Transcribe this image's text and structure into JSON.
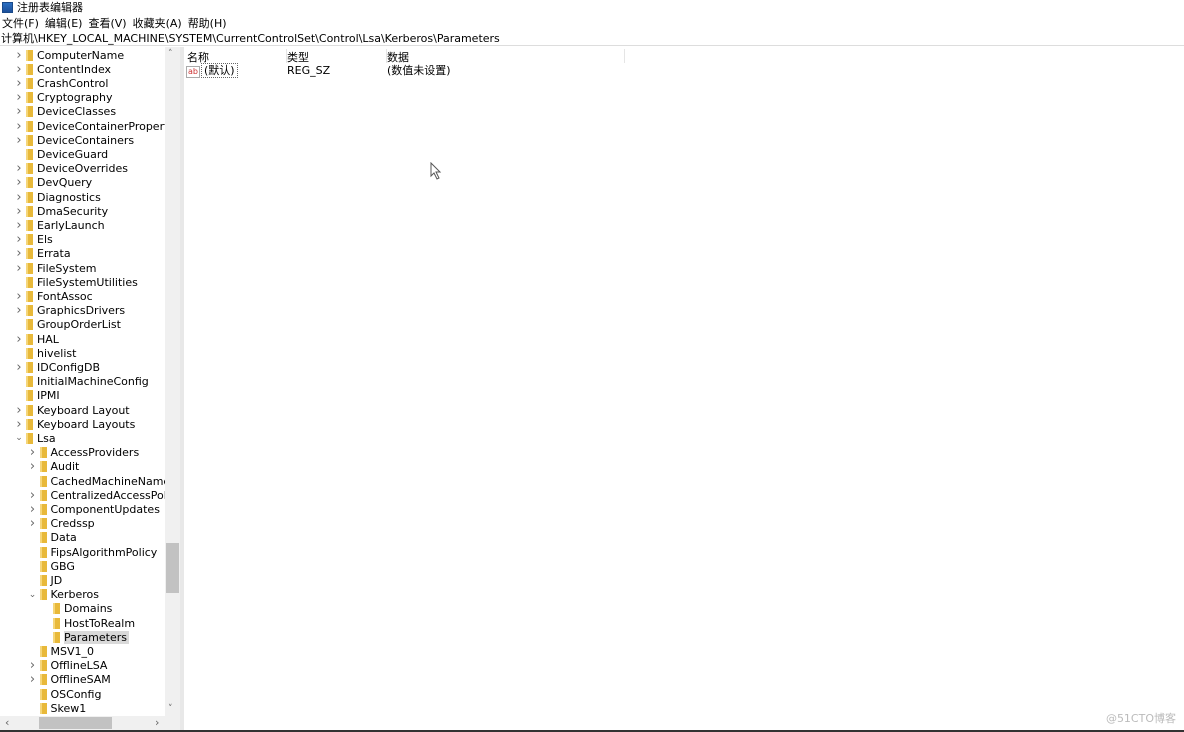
{
  "window": {
    "title": "注册表编辑器",
    "icon": "registry-editor-icon"
  },
  "menu": [
    "文件(F)",
    "编辑(E)",
    "查看(V)",
    "收藏夹(A)",
    "帮助(H)"
  ],
  "address": "计算机\\HKEY_LOCAL_MACHINE\\SYSTEM\\CurrentControlSet\\Control\\Lsa\\Kerberos\\Parameters",
  "tree": [
    {
      "label": "ComputerName",
      "level": 0,
      "state": "collapsed"
    },
    {
      "label": "ContentIndex",
      "level": 0,
      "state": "collapsed"
    },
    {
      "label": "CrashControl",
      "level": 0,
      "state": "collapsed"
    },
    {
      "label": "Cryptography",
      "level": 0,
      "state": "collapsed"
    },
    {
      "label": "DeviceClasses",
      "level": 0,
      "state": "collapsed"
    },
    {
      "label": "DeviceContainerPropertyU",
      "level": 0,
      "state": "collapsed"
    },
    {
      "label": "DeviceContainers",
      "level": 0,
      "state": "collapsed"
    },
    {
      "label": "DeviceGuard",
      "level": 0,
      "state": "leaf"
    },
    {
      "label": "DeviceOverrides",
      "level": 0,
      "state": "collapsed"
    },
    {
      "label": "DevQuery",
      "level": 0,
      "state": "collapsed"
    },
    {
      "label": "Diagnostics",
      "level": 0,
      "state": "collapsed"
    },
    {
      "label": "DmaSecurity",
      "level": 0,
      "state": "collapsed"
    },
    {
      "label": "EarlyLaunch",
      "level": 0,
      "state": "collapsed"
    },
    {
      "label": "Els",
      "level": 0,
      "state": "collapsed"
    },
    {
      "label": "Errata",
      "level": 0,
      "state": "collapsed"
    },
    {
      "label": "FileSystem",
      "level": 0,
      "state": "collapsed"
    },
    {
      "label": "FileSystemUtilities",
      "level": 0,
      "state": "leaf"
    },
    {
      "label": "FontAssoc",
      "level": 0,
      "state": "collapsed"
    },
    {
      "label": "GraphicsDrivers",
      "level": 0,
      "state": "collapsed"
    },
    {
      "label": "GroupOrderList",
      "level": 0,
      "state": "leaf"
    },
    {
      "label": "HAL",
      "level": 0,
      "state": "collapsed"
    },
    {
      "label": "hivelist",
      "level": 0,
      "state": "leaf"
    },
    {
      "label": "IDConfigDB",
      "level": 0,
      "state": "collapsed"
    },
    {
      "label": "InitialMachineConfig",
      "level": 0,
      "state": "leaf"
    },
    {
      "label": "IPMI",
      "level": 0,
      "state": "leaf"
    },
    {
      "label": "Keyboard Layout",
      "level": 0,
      "state": "collapsed"
    },
    {
      "label": "Keyboard Layouts",
      "level": 0,
      "state": "collapsed"
    },
    {
      "label": "Lsa",
      "level": 0,
      "state": "expanded"
    },
    {
      "label": "AccessProviders",
      "level": 1,
      "state": "collapsed"
    },
    {
      "label": "Audit",
      "level": 1,
      "state": "collapsed"
    },
    {
      "label": "CachedMachineNames",
      "level": 1,
      "state": "leaf"
    },
    {
      "label": "CentralizedAccessPolici",
      "level": 1,
      "state": "collapsed"
    },
    {
      "label": "ComponentUpdates",
      "level": 1,
      "state": "collapsed"
    },
    {
      "label": "Credssp",
      "level": 1,
      "state": "collapsed"
    },
    {
      "label": "Data",
      "level": 1,
      "state": "leaf"
    },
    {
      "label": "FipsAlgorithmPolicy",
      "level": 1,
      "state": "leaf"
    },
    {
      "label": "GBG",
      "level": 1,
      "state": "leaf"
    },
    {
      "label": "JD",
      "level": 1,
      "state": "leaf"
    },
    {
      "label": "Kerberos",
      "level": 1,
      "state": "expanded"
    },
    {
      "label": "Domains",
      "level": 2,
      "state": "leaf"
    },
    {
      "label": "HostToRealm",
      "level": 2,
      "state": "leaf"
    },
    {
      "label": "Parameters",
      "level": 2,
      "state": "leaf",
      "selected": true
    },
    {
      "label": "MSV1_0",
      "level": 1,
      "state": "leaf"
    },
    {
      "label": "OfflineLSA",
      "level": 1,
      "state": "collapsed"
    },
    {
      "label": "OfflineSAM",
      "level": 1,
      "state": "collapsed"
    },
    {
      "label": "OSConfig",
      "level": 1,
      "state": "leaf"
    },
    {
      "label": "Skew1",
      "level": 1,
      "state": "leaf"
    }
  ],
  "list": {
    "columns": [
      "名称",
      "类型",
      "数据"
    ],
    "rows": [
      {
        "name": "(默认)",
        "type": "REG_SZ",
        "data": "(数值未设置)",
        "icon": "string-value-icon"
      }
    ]
  },
  "watermark": "@51CTO博客"
}
